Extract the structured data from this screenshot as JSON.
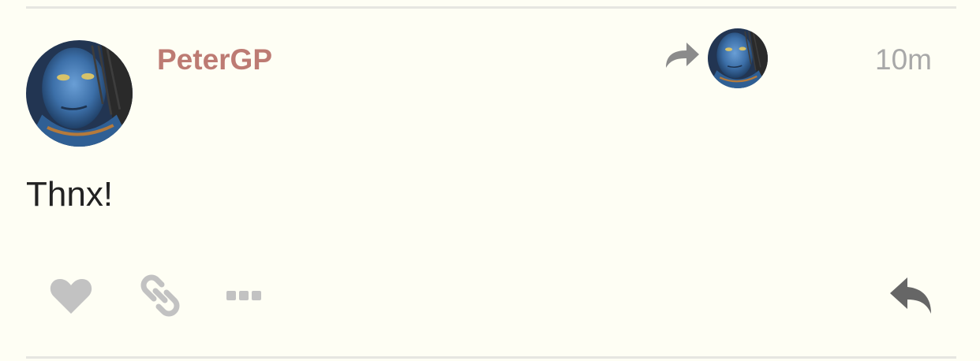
{
  "post": {
    "username": "PeterGP",
    "timestamp": "10m",
    "body": "Thnx!",
    "reply_to": {
      "indicator_icon": "share-forward-icon",
      "avatar": "reply-to-avatar"
    }
  },
  "actions": {
    "like_icon": "heart-icon",
    "link_icon": "link-icon",
    "more_icon": "ellipsis-icon",
    "reply_icon": "reply-icon"
  },
  "colors": {
    "background": "#fefef4",
    "username": "#bd7b73",
    "timestamp": "#a8a8a8",
    "body_text": "#222222",
    "icon_muted": "#c2c2c2",
    "icon_dark": "#666666",
    "divider": "#e6e6e1"
  }
}
